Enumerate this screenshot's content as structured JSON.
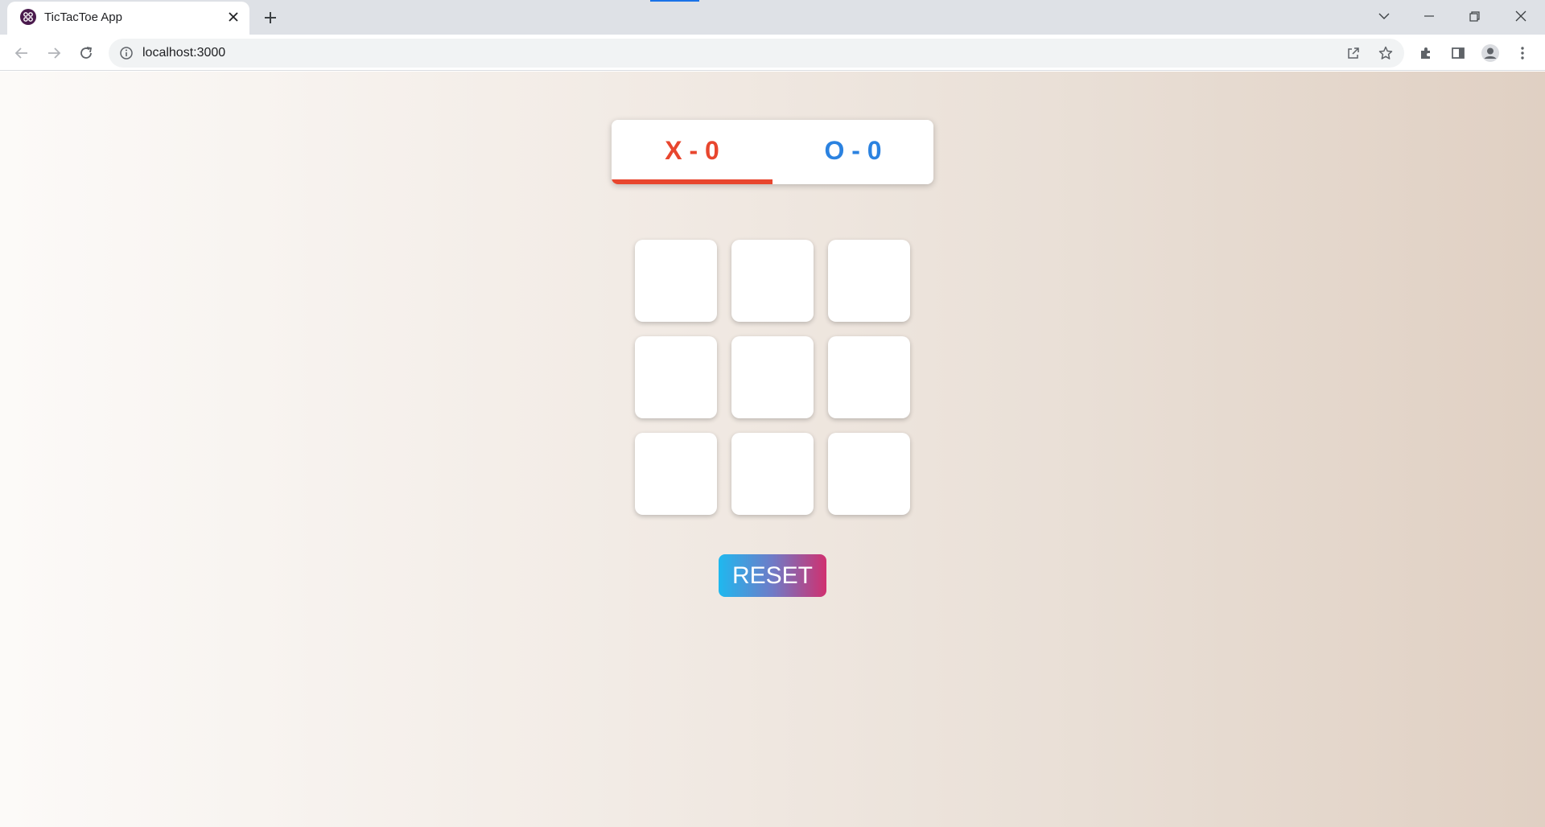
{
  "browser": {
    "tab_title": "TicTacToe App",
    "url": "localhost:3000"
  },
  "scoreboard": {
    "x_score": "X - 0",
    "o_score": "O - 0",
    "current_turn": "X",
    "x_color": "#e8462e",
    "o_color": "#2b82e0"
  },
  "board": {
    "cells": [
      "",
      "",
      "",
      "",
      "",
      "",
      "",
      "",
      ""
    ]
  },
  "reset_label": "RESET",
  "colors": {
    "reset_gradient_start": "#1fb8ef",
    "reset_gradient_end": "#d0306f"
  }
}
